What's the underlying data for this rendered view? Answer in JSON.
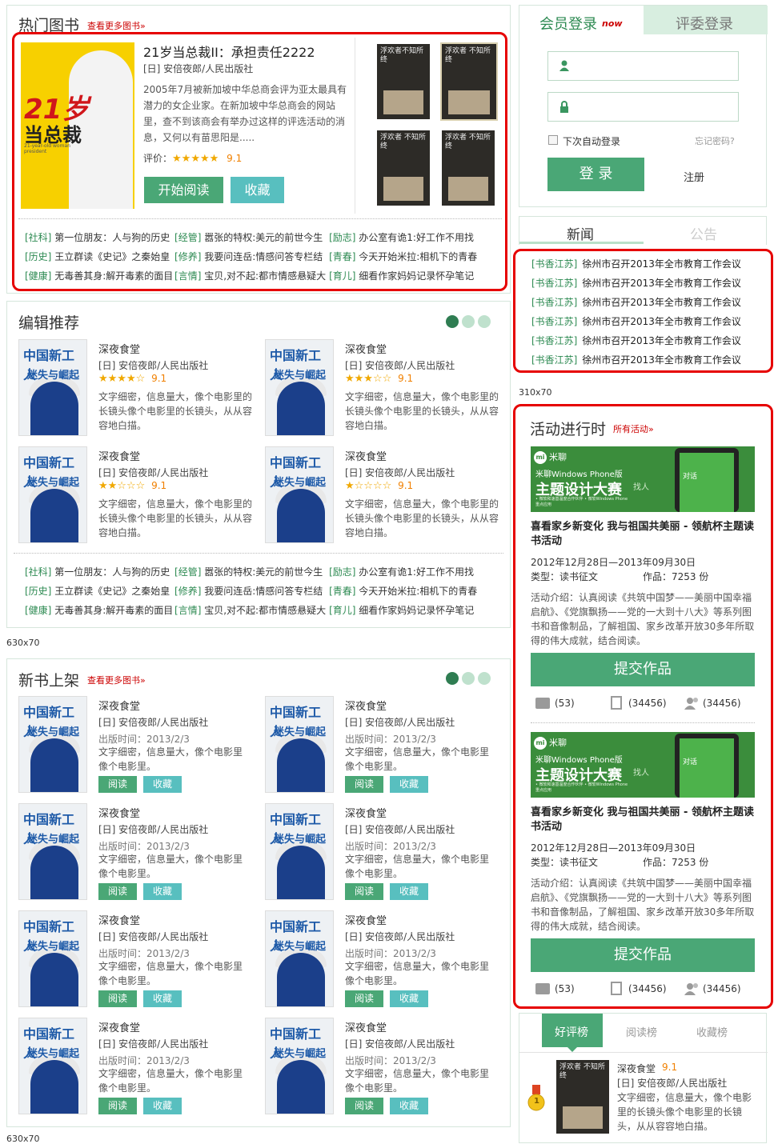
{
  "hot": {
    "title": "热门图书",
    "more": "查看更多图书»",
    "book_title": "21岁当总裁II：承担责任2222",
    "book_author": "[日] 安倍夜郎/人民出版社",
    "book_desc": "2005年7月被新加坡中华总商会评为亚太最具有潜力的女企业家。在新加坡中华总商会的网站里，查不到该商会有举办过这样的评选活动的消息，又何以有苗思阳是.....",
    "rating_label": "评价：",
    "rating_stars": "★★★★★",
    "rating_value": "9.1",
    "read_btn": "开始阅读",
    "fav_btn": "收藏",
    "cover_big": "21岁",
    "cover_main": "当总裁",
    "cover_sub": "21-year-old woman president",
    "thumb_title": "浮欢者不知所终",
    "thumb_title2": "浮欢者 不知所终",
    "links": [
      [
        "[社科]",
        "第一位朋友：人与狗的历史",
        "[经管]",
        "嚣张的特权:美元的前世今生",
        "[励志]",
        "办公室有诡1:好工作不用找"
      ],
      [
        "[历史]",
        "王立群读《史记》之秦始皇",
        "[修养]",
        "我要问连岳:情感问答专栏结",
        "[青春]",
        "今天开始米拉:相机下的青春"
      ],
      [
        "[健康]",
        "无毒善其身:解开毒素的面目",
        "[言情]",
        "宝贝,对不起:都市情感悬疑大",
        "[育儿]",
        "细看作家妈妈记录怀孕笔记"
      ]
    ]
  },
  "editor": {
    "title": "编辑推荐",
    "books": [
      {
        "title": "深夜食堂",
        "author": "[日] 安倍夜郎/人民出版社",
        "stars": "★★★★☆",
        "score": "9.1",
        "desc": "文字细密，信息量大，像个电影里的长镜头像个电影里的长镜头，从从容容地白描。"
      },
      {
        "title": "深夜食堂",
        "author": "[日] 安倍夜郎/人民出版社",
        "stars": "★★★☆☆",
        "score": "9.1",
        "desc": "文字细密，信息量大，像个电影里的长镜头像个电影里的长镜头，从从容容地白描。"
      },
      {
        "title": "深夜食堂",
        "author": "[日] 安倍夜郎/人民出版社",
        "stars": "★★☆☆☆",
        "score": "9.1",
        "desc": "文字细密，信息量大，像个电影里的长镜头像个电影里的长镜头，从从容容地白描。"
      },
      {
        "title": "深夜食堂",
        "author": "[日] 安倍夜郎/人民出版社",
        "stars": "★☆☆☆☆",
        "score": "9.1",
        "desc": "文字细密，信息量大，像个电影里的长镜头像个电影里的长镜头，从从容容地白描。"
      }
    ],
    "cover_line1": "中国新工人",
    "cover_line2": "迷失与崛起",
    "links": [
      [
        "[社科]",
        "第一位朋友：人与狗的历史",
        "[经管]",
        "嚣张的特权:美元的前世今生",
        "[励志]",
        "办公室有诡1:好工作不用找"
      ],
      [
        "[历史]",
        "王立群读《史记》之秦始皇",
        "[修养]",
        "我要问连岳:情感问答专栏结",
        "[青春]",
        "今天开始米拉:相机下的青春"
      ],
      [
        "[健康]",
        "无毒善其身:解开毒素的面目",
        "[言情]",
        "宝贝,对不起:都市情感悬疑大",
        "[育儿]",
        "细看作家妈妈记录怀孕笔记"
      ]
    ]
  },
  "size_label1": "630x70",
  "size_label2": "630x70",
  "size_label3": "310x70",
  "newbooks": {
    "title": "新书上架",
    "more": "查看更多图书»",
    "book_title": "深夜食堂",
    "book_author": "[日] 安倍夜郎/人民出版社",
    "book_date": "出版时间：2013/2/3",
    "book_desc": "文字细密，信息量大，像个电影里像个电影里。",
    "read_btn": "阅读",
    "fav_btn": "收藏"
  },
  "login": {
    "tab_member": "会员登录",
    "tab_now": "now",
    "tab_judge": "评委登录",
    "remember": "下次自动登录",
    "forgot": "忘记密码?",
    "login_btn": "登 录",
    "register": "注册"
  },
  "news": {
    "tab_news": "新闻",
    "tab_notice": "公告",
    "tag": "[书香江苏]",
    "items": [
      "徐州市召开2013年全市教育工作会议",
      "徐州市召开2013年全市教育工作会议",
      "徐州市召开2013年全市教育工作会议",
      "徐州市召开2013年全市教育工作会议",
      "徐州市召开2013年全市教育工作会议",
      "徐州市召开2013年全市教育工作会议"
    ]
  },
  "activity": {
    "title": "活动进行时",
    "more": "所有活动»",
    "banner_brand": "米聊",
    "banner_line1": "米聊Windows Phone版",
    "banner_line2": "主题设计大赛",
    "banner_small": "• 微软和速基温度合作伙伴 • 微软Windows Phone重点应用",
    "banner_chat": "对话",
    "banner_find": "找人",
    "item_title": "喜看家乡新变化 我与祖国共美丽 - 领航杯主题读书活动",
    "item_date": "2012年12月28日—2013年09月30日",
    "item_type": "类型：读书征文",
    "item_count": "作品：7253 份",
    "item_desc": "活动介绍：认真阅读《共筑中国梦——美丽中国幸福启航》、《党旗飘扬——党的一大到十八大》等系列图书和音像制品，了解祖国、家乡改革开放30多年所取得的伟大成就，结合阅读。",
    "submit_btn": "提交作品",
    "stat1": "(53)",
    "stat2": "(34456)",
    "stat3": "(34456)"
  },
  "rank": {
    "tab1": "好评榜",
    "tab2": "阅读榜",
    "tab3": "收藏榜",
    "book_title": "深夜食堂",
    "book_score": "9.1",
    "book_author": "[日] 安倍夜郎/人民出版社",
    "book_desc": "文字细密，信息量大，像个电影里的长镜头像个电影里的长镜头，从从容容地白描。",
    "medal": "1"
  },
  "colors": {
    "accent": "#4aa776",
    "red": "#e60000",
    "link": "#2d8a52"
  }
}
